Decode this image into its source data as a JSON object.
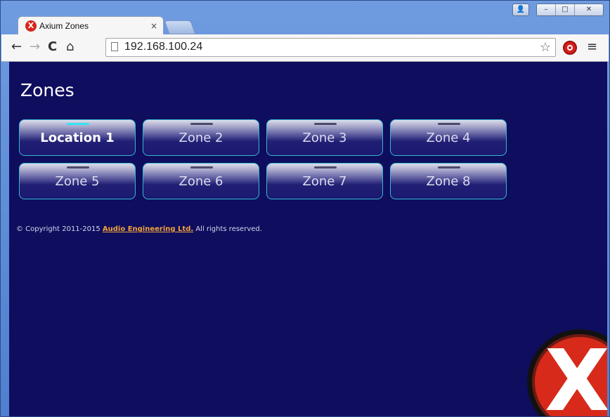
{
  "browser": {
    "tab_title": "Axium Zones",
    "tab_icon_glyph": "X",
    "tab_close_glyph": "×",
    "url": "192.168.100.24",
    "nav": {
      "back_glyph": "←",
      "forward_glyph": "→",
      "reload_glyph": "C",
      "home_glyph": "⌂"
    },
    "star_glyph": "☆",
    "menu_glyph": "≡",
    "window_controls": {
      "user_glyph": "👤",
      "minimize_glyph": "–",
      "maximize_glyph": "□",
      "close_glyph": "✕"
    }
  },
  "page": {
    "title": "Zones",
    "zones": [
      {
        "label": "Location 1",
        "active": true
      },
      {
        "label": "Zone 2",
        "active": false
      },
      {
        "label": "Zone 3",
        "active": false
      },
      {
        "label": "Zone 4",
        "active": false
      },
      {
        "label": "Zone 5",
        "active": false
      },
      {
        "label": "Zone 6",
        "active": false
      },
      {
        "label": "Zone 7",
        "active": false
      },
      {
        "label": "Zone 8",
        "active": false
      }
    ],
    "footer": {
      "prefix": "© Copyright 2011-2015 ",
      "link": "Audio Engineering Ltd.",
      "suffix": " All rights reserved."
    },
    "logo_glyph": "X"
  },
  "colors": {
    "page_bg": "#0f0d5e",
    "zone_border": "#35b9d0",
    "active_indicator": "#36e3f2",
    "link": "#f0a23a",
    "logo_red": "#d72a1a"
  }
}
